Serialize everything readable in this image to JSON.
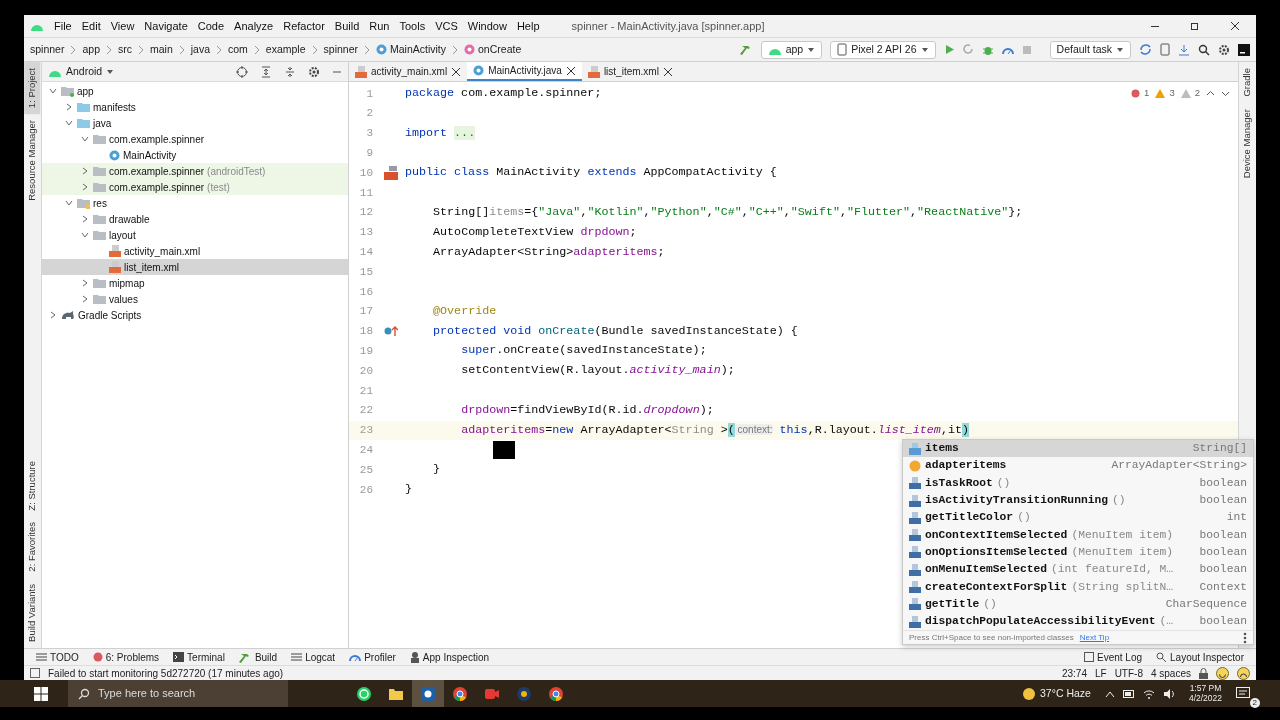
{
  "window": {
    "title": "spinner - MainActivity.java [spinner.app]"
  },
  "menu": [
    "File",
    "Edit",
    "View",
    "Navigate",
    "Code",
    "Analyze",
    "Refactor",
    "Build",
    "Run",
    "Tools",
    "VCS",
    "Window",
    "Help"
  ],
  "breadcrumbs": [
    {
      "label": "spinner",
      "kind": "plain"
    },
    {
      "label": "app",
      "kind": "plain"
    },
    {
      "label": "src",
      "kind": "plain"
    },
    {
      "label": "main",
      "kind": "plain"
    },
    {
      "label": "java",
      "kind": "plain"
    },
    {
      "label": "com",
      "kind": "plain"
    },
    {
      "label": "example",
      "kind": "plain"
    },
    {
      "label": "spinner",
      "kind": "plain"
    },
    {
      "label": "MainActivity",
      "kind": "class"
    },
    {
      "label": "onCreate",
      "kind": "method"
    }
  ],
  "toolbar": {
    "module": "app",
    "device": "Pixel 2 API 26",
    "task": "Default task"
  },
  "left_strip": {
    "top": [
      {
        "label": "1: Project",
        "selected": true
      },
      {
        "label": "Resource Manager",
        "selected": false
      }
    ],
    "bottom": [
      {
        "label": "Z: Structure",
        "selected": false
      },
      {
        "label": "2: Favorites",
        "selected": false
      },
      {
        "label": "Build Variants",
        "selected": false
      }
    ]
  },
  "right_strip": [
    "Gradle",
    "Device Manager"
  ],
  "project_panel": {
    "view": "Android",
    "tree": [
      {
        "label": "app",
        "kind": "module",
        "expanded": true,
        "selected": false,
        "highlighted": false,
        "children": [
          {
            "label": "manifests",
            "kind": "folder",
            "expanded": false,
            "selected": false,
            "highlighted": false
          },
          {
            "label": "java",
            "kind": "folder",
            "expanded": true,
            "selected": false,
            "highlighted": false,
            "children": [
              {
                "label": "com.example.spinner",
                "kind": "package",
                "expanded": true,
                "selected": false,
                "highlighted": false,
                "children": [
                  {
                    "label": "MainActivity",
                    "kind": "class",
                    "selected": false,
                    "highlighted": false
                  }
                ]
              },
              {
                "label": "com.example.spinner",
                "suffix": "(androidTest)",
                "kind": "package",
                "expanded": false,
                "selected": false,
                "highlighted": true
              },
              {
                "label": "com.example.spinner",
                "suffix": "(test)",
                "kind": "package",
                "expanded": false,
                "selected": false,
                "highlighted": true
              }
            ]
          },
          {
            "label": "res",
            "kind": "resfolder",
            "expanded": true,
            "selected": false,
            "highlighted": false,
            "children": [
              {
                "label": "drawable",
                "kind": "package",
                "expanded": false,
                "selected": false,
                "highlighted": false
              },
              {
                "label": "layout",
                "kind": "package",
                "expanded": true,
                "selected": false,
                "highlighted": false,
                "children": [
                  {
                    "label": "activity_main.xml",
                    "kind": "xml",
                    "selected": false,
                    "highlighted": false
                  },
                  {
                    "label": "list_item.xml",
                    "kind": "xml",
                    "selected": true,
                    "highlighted": false
                  }
                ]
              },
              {
                "label": "mipmap",
                "kind": "package",
                "expanded": false,
                "selected": false,
                "highlighted": false
              },
              {
                "label": "values",
                "kind": "package",
                "expanded": false,
                "selected": false,
                "highlighted": false
              }
            ]
          }
        ]
      },
      {
        "label": "Gradle Scripts",
        "kind": "gradle",
        "expanded": false,
        "selected": false,
        "highlighted": false
      }
    ]
  },
  "editor": {
    "tabs": [
      {
        "label": "activity_main.xml",
        "kind": "xml",
        "selected": false
      },
      {
        "label": "MainActivity.java",
        "kind": "class",
        "selected": true
      },
      {
        "label": "list_item.xml",
        "kind": "xml",
        "selected": false
      }
    ],
    "inspections": [
      {
        "kind": "error",
        "count": "1"
      },
      {
        "kind": "warning",
        "count": "3"
      },
      {
        "kind": "weak",
        "count": "2"
      }
    ],
    "lines": [
      {
        "number": "1",
        "current": false,
        "segments": [
          {
            "text": "package",
            "kind": "kw"
          },
          {
            "text": " com.example.spinner;",
            "kind": "plain"
          }
        ]
      },
      {
        "number": "2",
        "current": false
      },
      {
        "number": "3",
        "current": false,
        "segments": [
          {
            "text": "import ",
            "kind": "kw"
          },
          {
            "text": "...",
            "kind": "fold"
          }
        ]
      },
      {
        "number": "9",
        "current": false
      },
      {
        "number": "10",
        "current": false,
        "marker": {
          "kind": "activity"
        },
        "segments": [
          {
            "text": "public class",
            "kind": "kw"
          },
          {
            "text": " MainActivity ",
            "kind": "plain"
          },
          {
            "text": "extends",
            "kind": "kw"
          },
          {
            "text": " AppCompatActivity {",
            "kind": "plain"
          }
        ]
      },
      {
        "number": "11",
        "current": false
      },
      {
        "number": "12",
        "current": false,
        "segments": [
          {
            "text": "    String[]",
            "kind": "plain"
          },
          {
            "text": "items",
            "kind": "gray"
          },
          {
            "text": "={",
            "kind": "plain"
          },
          {
            "text": "\"Java\"",
            "kind": "str"
          },
          {
            "text": ",",
            "kind": "plain"
          },
          {
            "text": "\"Kotlin\"",
            "kind": "str"
          },
          {
            "text": ",",
            "kind": "plain"
          },
          {
            "text": "\"Python\"",
            "kind": "str"
          },
          {
            "text": ",",
            "kind": "plain"
          },
          {
            "text": "\"C#\"",
            "kind": "str"
          },
          {
            "text": ",",
            "kind": "plain"
          },
          {
            "text": "\"C++\"",
            "kind": "str"
          },
          {
            "text": ",",
            "kind": "plain"
          },
          {
            "text": "\"Swift\"",
            "kind": "str"
          },
          {
            "text": ",",
            "kind": "plain"
          },
          {
            "text": "\"Flutter\"",
            "kind": "str"
          },
          {
            "text": ",",
            "kind": "plain"
          },
          {
            "text": "\"ReactNative\"",
            "kind": "str"
          },
          {
            "text": "};",
            "kind": "plain"
          }
        ]
      },
      {
        "number": "13",
        "current": false,
        "segments": [
          {
            "text": "    AutoCompleteTextView ",
            "kind": "plain"
          },
          {
            "text": "drpdown",
            "kind": "field"
          },
          {
            "text": ";",
            "kind": "plain"
          }
        ]
      },
      {
        "number": "14",
        "current": false,
        "segments": [
          {
            "text": "    ArrayAdapter<String>",
            "kind": "plain"
          },
          {
            "text": "adapteritems",
            "kind": "field"
          },
          {
            "text": ";",
            "kind": "plain"
          }
        ]
      },
      {
        "number": "15",
        "current": false
      },
      {
        "number": "16",
        "current": false
      },
      {
        "number": "17",
        "current": false,
        "segments": [
          {
            "text": "    @Override",
            "kind": "ann"
          }
        ]
      },
      {
        "number": "18",
        "current": false,
        "marker": {
          "kind": "override"
        },
        "segments": [
          {
            "text": "    protected void ",
            "kind": "kw"
          },
          {
            "text": "onCreate",
            "kind": "method"
          },
          {
            "text": "(Bundle savedInstanceState) {",
            "kind": "plain"
          }
        ]
      },
      {
        "number": "19",
        "current": false,
        "segments": [
          {
            "text": "        super",
            "kind": "kw"
          },
          {
            "text": ".onCreate(savedInstanceState);",
            "kind": "plain"
          }
        ]
      },
      {
        "number": "20",
        "current": false,
        "segments": [
          {
            "text": "        setContentView(R.layout.",
            "kind": "plain"
          },
          {
            "text": "activity_main",
            "kind": "static"
          },
          {
            "text": ");",
            "kind": "plain"
          }
        ]
      },
      {
        "number": "21",
        "current": false
      },
      {
        "number": "22",
        "current": false,
        "segments": [
          {
            "text": "        drpdown",
            "kind": "field"
          },
          {
            "text": "=findViewById(R.id.",
            "kind": "plain"
          },
          {
            "text": "dropdown",
            "kind": "static"
          },
          {
            "text": ");",
            "kind": "plain"
          }
        ]
      },
      {
        "number": "23",
        "current": true,
        "segments": [
          {
            "text": "        adapteritems",
            "kind": "field"
          },
          {
            "text": "=",
            "kind": "plain"
          },
          {
            "text": "new",
            "kind": "kw"
          },
          {
            "text": " ArrayAdapter<",
            "kind": "plain"
          },
          {
            "text": "String",
            "kind": "gray"
          },
          {
            "text": " >",
            "kind": "plain"
          },
          {
            "text": "(",
            "kind": "brace"
          },
          {
            "text": " context:",
            "kind": "hint"
          },
          {
            "text": " this",
            "kind": "kw"
          },
          {
            "text": ",R.layout.",
            "kind": "plain"
          },
          {
            "text": "list_item",
            "kind": "static"
          },
          {
            "text": ",it",
            "kind": "plain"
          },
          {
            "text": ")",
            "kind": "brace"
          }
        ]
      },
      {
        "number": "24",
        "current": false,
        "cursor": true
      },
      {
        "number": "25",
        "current": false,
        "segments": [
          {
            "text": "    }",
            "kind": "plain"
          }
        ]
      },
      {
        "number": "26",
        "current": false,
        "segments": [
          {
            "text": "}",
            "kind": "plain"
          }
        ]
      }
    ]
  },
  "completion": {
    "items": [
      {
        "name": "items",
        "kind": "variable",
        "type": "String[]",
        "selected": true
      },
      {
        "name": "adapteritems",
        "kind": "field",
        "type": "ArrayAdapter<String>",
        "selected": false
      },
      {
        "name": "isTaskRoot",
        "params": "()",
        "kind": "method",
        "type": "boolean",
        "selected": false
      },
      {
        "name": "isActivityTransitionRunning",
        "params": "()",
        "kind": "method",
        "type": "boolean",
        "selected": false
      },
      {
        "name": "getTitleColor",
        "params": "()",
        "kind": "method",
        "type": "int",
        "selected": false
      },
      {
        "name": "onContextItemSelected",
        "params": "(MenuItem item)",
        "kind": "method",
        "type": "boolean",
        "selected": false
      },
      {
        "name": "onOptionsItemSelected",
        "params": "(MenuItem item)",
        "kind": "method",
        "type": "boolean",
        "selected": false
      },
      {
        "name": "onMenuItemSelected",
        "params": "(int featureId, M…",
        "kind": "method",
        "type": "boolean",
        "selected": false
      },
      {
        "name": "createContextForSplit",
        "params": "(String splitN…",
        "kind": "method",
        "type": "Context",
        "selected": false
      },
      {
        "name": "getTitle",
        "params": "()",
        "kind": "method",
        "type": "CharSequence",
        "selected": false
      },
      {
        "name": "dispatchPopulateAccessibilityEvent",
        "params": "(…",
        "kind": "method",
        "type": "boolean",
        "selected": false
      }
    ],
    "footer": "Press Ctrl+Space to see non-imported classes",
    "tip_link": "Next Tip"
  },
  "tool_tabs": [
    {
      "label": "TODO",
      "kind": "list"
    },
    {
      "label": "6: Problems",
      "kind": "problems"
    },
    {
      "label": "Terminal",
      "kind": "terminal"
    },
    {
      "label": "Build",
      "kind": "hammer"
    },
    {
      "label": "Logcat",
      "kind": "list"
    },
    {
      "label": "Profiler",
      "kind": "gauge"
    },
    {
      "label": "App Inspection",
      "kind": "inspect"
    }
  ],
  "right_tool_tabs": [
    "Event Log",
    "Layout Inspector"
  ],
  "status": {
    "message": "Failed to start monitoring 5d272720 (17 minutes ago)",
    "items": [
      "23:74",
      "LF",
      "UTF-8",
      "4 spaces"
    ]
  },
  "taskbar": {
    "search_placeholder": "Type here to search",
    "apps": [
      {
        "kind": "whatsapp",
        "selected": false
      },
      {
        "kind": "explorer",
        "selected": false
      },
      {
        "kind": "bluebox",
        "selected": true
      },
      {
        "kind": "chrome",
        "selected": false
      },
      {
        "kind": "video",
        "selected": false
      },
      {
        "kind": "darkapp",
        "selected": false
      },
      {
        "kind": "chrome",
        "selected": false
      }
    ],
    "weather": "37°C Haze",
    "time": "1:57 PM",
    "date": "4/2/2022",
    "notifications": "2"
  }
}
